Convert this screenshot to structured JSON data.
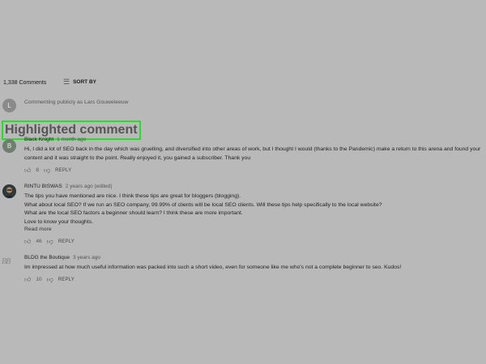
{
  "header": {
    "comment_count": "1,338 Comments",
    "sort_label": "SORT BY",
    "sort_icon": "sort-icon"
  },
  "commenting_as": {
    "avatar_letter": "L",
    "text": "Commenting publicly as Lars Gouweleeuw"
  },
  "highlight_label": "Highlighted comment",
  "highlight_color": "#22e022",
  "comments": [
    {
      "avatar_letter": "B",
      "author": "Black Knight",
      "time": "1 month ago",
      "lines": [
        "Hi, I did a lot of SEO back in the day which was gruelling, and diversified into other areas of work, but I thought I would (thanks to the Pandemic) make a return to this arena and found your",
        "content and it was straight to the point. Really enjoyed it, you gained a subscriber. Thank you"
      ],
      "likes": "8",
      "reply": "REPLY"
    },
    {
      "author": "RINTU BISWAS",
      "time": "2 years ago (edited)",
      "lines": [
        "The tips you have mentioned are nice. I think these tips are great for bloggers (blogging).",
        "What about local SEO? If we run an SEO company, 99.99% of clients will be local SEO clients. Will these tips help specifically to the local website?",
        "What are the local SEO factors a beginner should learn? I think these are more important.",
        "Love to know your thoughts."
      ],
      "read_more": "Read more",
      "likes": "46",
      "reply": "REPLY"
    },
    {
      "avatar_letter": "BB",
      "author": "BLDG the Boutique",
      "time": "3 years ago",
      "lines": [
        "Im impressed at how much useful information was packed into such a short video, even for someone like me who's not a complete beginner to seo.  Kudos!"
      ],
      "likes": "10",
      "reply": "REPLY"
    }
  ]
}
